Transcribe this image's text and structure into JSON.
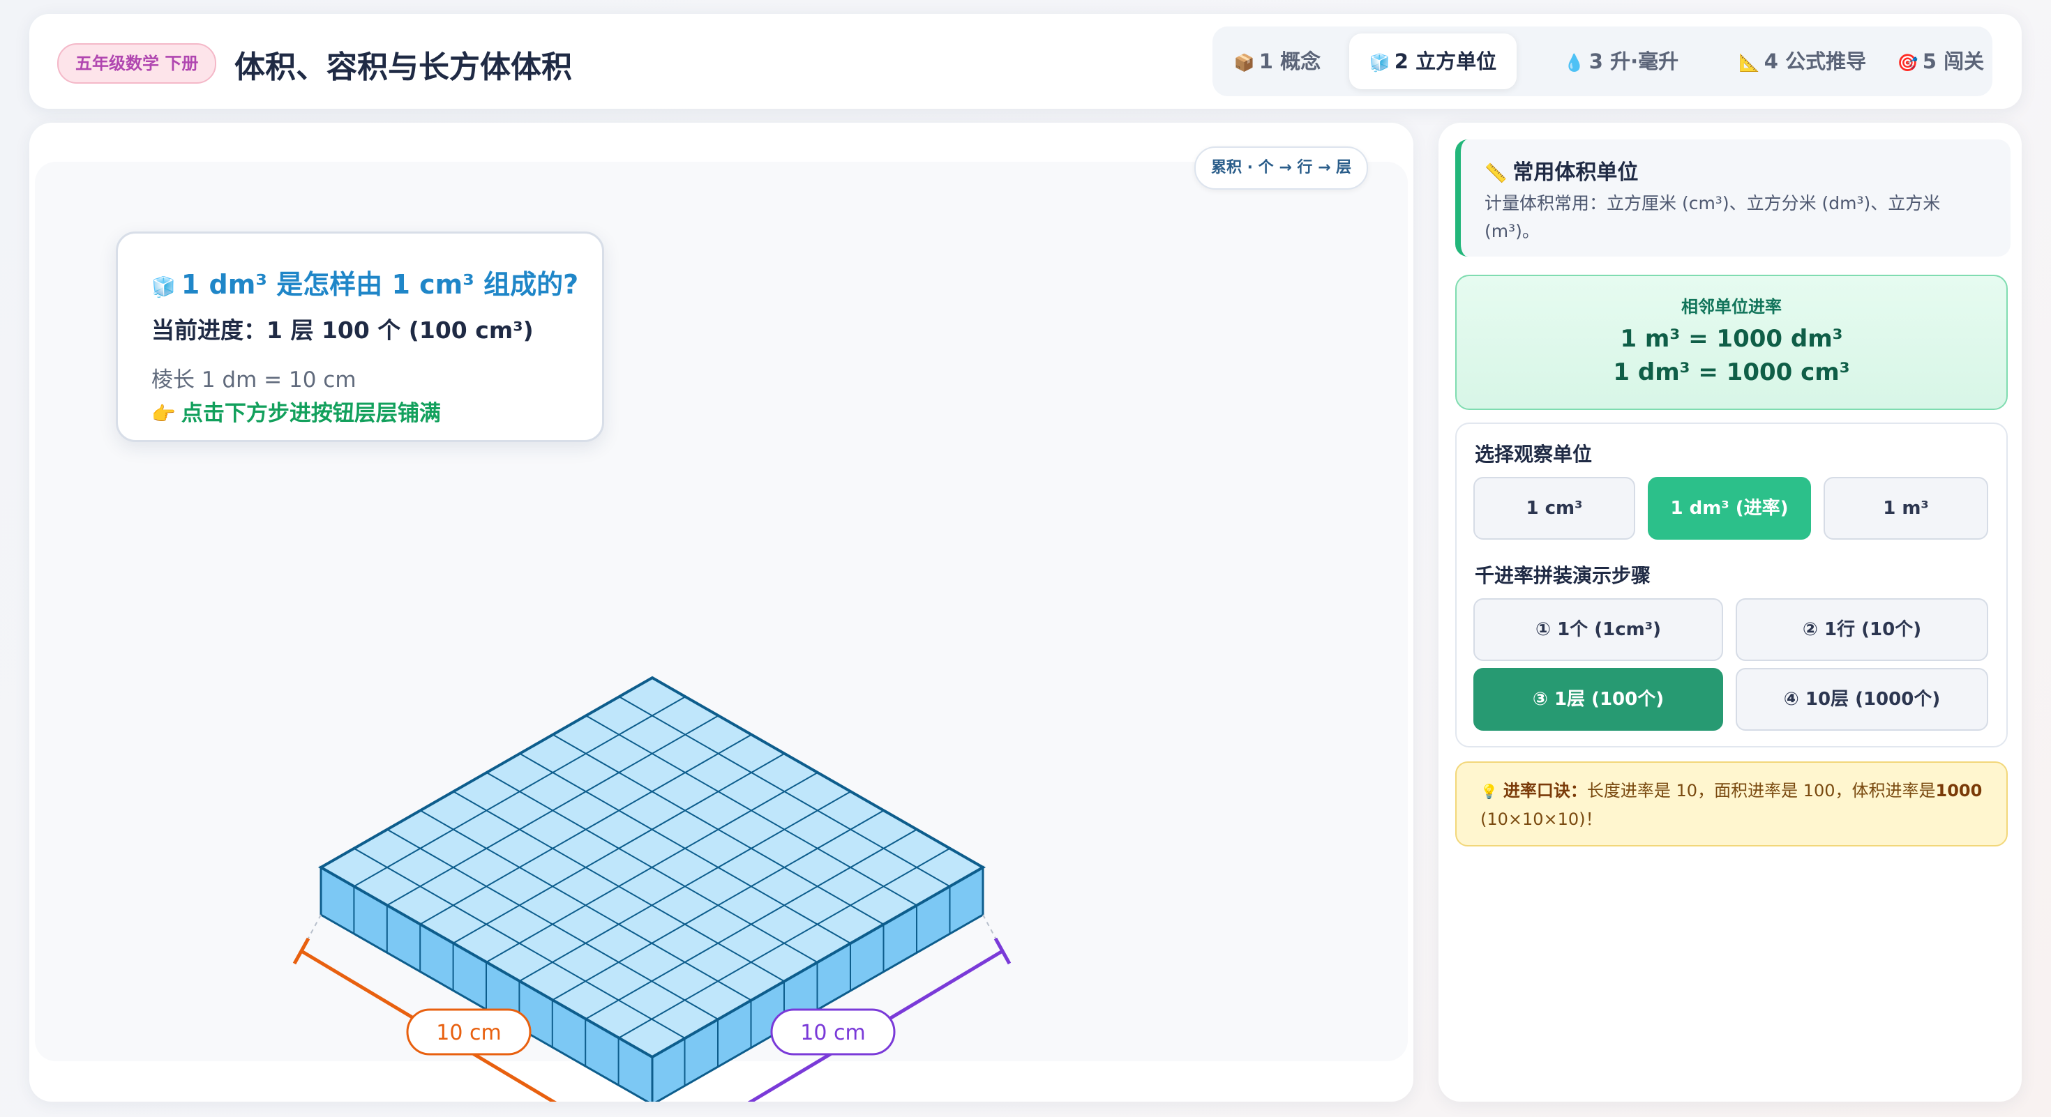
{
  "header": {
    "grade_badge": "五年级数学 下册",
    "title": "体积、容积与长方体体积",
    "tabs": [
      {
        "icon": "📦",
        "label": "1 概念"
      },
      {
        "icon": "🧊",
        "label": "2 立方单位"
      },
      {
        "icon": "💧",
        "label": "3 升·毫升"
      },
      {
        "icon": "📐",
        "label": "4 公式推导"
      },
      {
        "icon": "🎯",
        "label": "5 闯关"
      }
    ],
    "active_tab": 1
  },
  "stage": {
    "mode_pill": "累积 · 个 → 行 → 层",
    "info": {
      "icon": "🧊",
      "title": "1 dm³ 是怎样由 1 cm³ 组成的?",
      "progress": "当前进度：1 层 100 个 (100 cm³)",
      "edge": "棱长 1 dm = 10 cm",
      "hint_icon": "👉",
      "hint": "点击下方步进按钮层层铺满"
    },
    "cube": {
      "rows": 10,
      "cols": 10,
      "layers": 1,
      "left_label": "10 cm",
      "right_label": "10 cm",
      "top_color": "#bfe6fb",
      "side_color": "#7cc8f4",
      "edge_color": "#0d5d8c",
      "left_dim_color": "#e8600f",
      "right_dim_color": "#7a3ad8"
    }
  },
  "side": {
    "units": {
      "icon": "📏",
      "title": "常用体积单位",
      "desc": "计量体积常用：立方厘米 (cm³)、立方分米 (dm³)、立方米 (m³)。"
    },
    "rate": {
      "label": "相邻单位进率",
      "line1": "1 m³ = 1000 dm³",
      "line2": "1 dm³ = 1000 cm³"
    },
    "select_label": "选择观察单位",
    "unit_buttons": [
      "1 cm³",
      "1 dm³ (进率)",
      "1 m³"
    ],
    "steps_label": "千进率拼装演示步骤",
    "step_buttons": [
      "① 1个 (1cm³)",
      "② 1行 (10个)",
      "③ 1层 (100个)",
      "④ 10层 (1000个)"
    ],
    "tip": {
      "icon": "💡",
      "strong": "进率口诀：",
      "text": "长度进率是 10，面积进率是 100，体积进率是",
      "strong2": "1000",
      "text2": " (10×10×10)！"
    }
  }
}
